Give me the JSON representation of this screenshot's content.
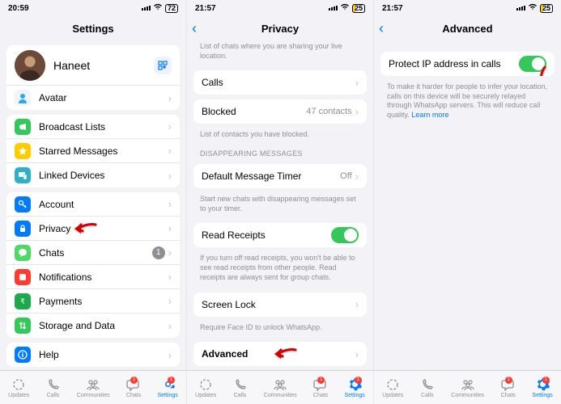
{
  "colors": {
    "accent": "#007aff",
    "toggle_on": "#34c759",
    "badge_red": "#ff3b30",
    "grey_bg": "#f2f2f7"
  },
  "screens": [
    {
      "status": {
        "time": "20:59",
        "battery": "72",
        "battery_low": false
      },
      "header": {
        "title": "Settings",
        "back": false
      },
      "profile": {
        "name": "Haneet",
        "sub": ""
      },
      "rows1": [
        {
          "icon": "avatar",
          "color": "#f2f2f7",
          "label": "Avatar"
        }
      ],
      "rows2": [
        {
          "icon": "megaphone",
          "color": "#34c759",
          "label": "Broadcast Lists"
        },
        {
          "icon": "star",
          "color": "#ffcc00",
          "label": "Starred Messages"
        },
        {
          "icon": "devices",
          "color": "#30b0c7",
          "label": "Linked Devices"
        }
      ],
      "rows3": [
        {
          "icon": "key",
          "color": "#007aff",
          "label": "Account"
        },
        {
          "icon": "lock",
          "color": "#007aff",
          "label": "Privacy",
          "arrow": true
        },
        {
          "icon": "chat",
          "color": "#4cd964",
          "label": "Chats",
          "badge": "1"
        },
        {
          "icon": "bell",
          "color": "#ff3b30",
          "label": "Notifications"
        },
        {
          "icon": "payments",
          "color": "#1ba94c",
          "label": "Payments"
        },
        {
          "icon": "data",
          "color": "#34c759",
          "label": "Storage and Data"
        }
      ],
      "rows4": [
        {
          "icon": "info",
          "color": "#007aff",
          "label": "Help"
        }
      ]
    },
    {
      "status": {
        "time": "21:57",
        "battery": "25",
        "battery_low": true
      },
      "header": {
        "title": "Privacy",
        "back": true
      },
      "caption_location": "List of chats where you are sharing your live location.",
      "calls_label": "Calls",
      "blocked": {
        "label": "Blocked",
        "value": "47 contacts"
      },
      "caption_blocked": "List of contacts you have blocked.",
      "section_disappearing": "Disappearing Messages",
      "timer": {
        "label": "Default Message Timer",
        "value": "Off"
      },
      "caption_timer": "Start new chats with disappearing messages set to your timer.",
      "receipts": {
        "label": "Read Receipts"
      },
      "caption_receipts": "If you turn off read receipts, you won't be able to see read receipts from other people. Read receipts are always sent for group chats.",
      "screenlock": {
        "label": "Screen Lock"
      },
      "caption_lock": "Require Face ID to unlock WhatsApp.",
      "advanced": {
        "label": "Advanced",
        "arrow": true
      }
    },
    {
      "status": {
        "time": "21:57",
        "battery": "25",
        "battery_low": true
      },
      "header": {
        "title": "Advanced",
        "back": true
      },
      "protect": {
        "label": "Protect IP address in calls"
      },
      "caption_protect_a": "To make it harder for people to infer your location, calls on this device will be securely relayed through WhatsApp servers. This will reduce call quality. ",
      "caption_protect_link": "Learn more"
    }
  ],
  "tabs": [
    {
      "label": "Updates",
      "icon": "updates"
    },
    {
      "label": "Calls",
      "icon": "calls"
    },
    {
      "label": "Communities",
      "icon": "communities"
    },
    {
      "label": "Chats",
      "icon": "chats",
      "dot": "1"
    },
    {
      "label": "Settings",
      "icon": "settings",
      "dot": "1",
      "selected": true
    }
  ]
}
